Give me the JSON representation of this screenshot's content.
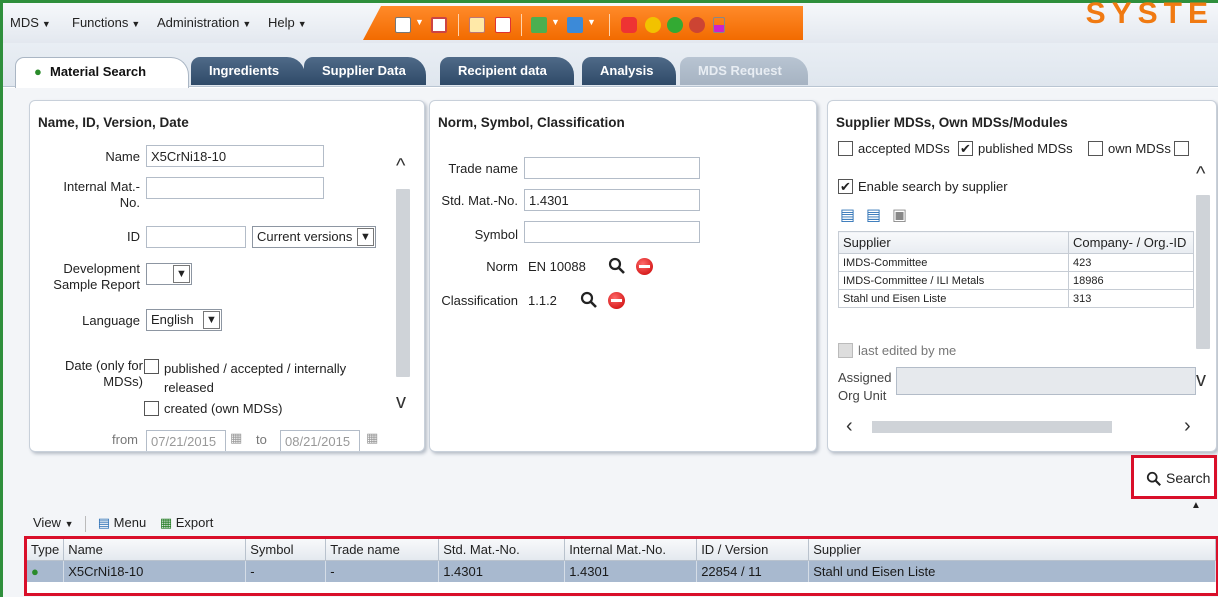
{
  "menu": {
    "items": [
      "MDS",
      "Functions",
      "Administration",
      "Help"
    ],
    "brand": "SYSTE"
  },
  "tabs": [
    {
      "label": "Material Search",
      "state": "active"
    },
    {
      "label": "Ingredients",
      "state": "normal"
    },
    {
      "label": "Supplier Data",
      "state": "normal"
    },
    {
      "label": "Recipient data",
      "state": "normal"
    },
    {
      "label": "Analysis",
      "state": "normal"
    },
    {
      "label": "MDS Request",
      "state": "disabled"
    }
  ],
  "panel_name": {
    "title": "Name, ID, Version, Date",
    "name_label": "Name",
    "name_value": "X5CrNi18-10",
    "internal_label": "Internal Mat.-No.",
    "internal_value": "",
    "id_label": "ID",
    "id_value": "",
    "version_select": "Current versions",
    "dev_label": "Development Sample Report",
    "dev_select": "",
    "language_label": "Language",
    "language_select": "English",
    "date_label": "Date (only for MDSs)",
    "published_label": "published / accepted / internally released",
    "created_label": "created (own MDSs)",
    "from_label": "from",
    "from_value": "07/21/2015",
    "to_label": "to",
    "to_value": "08/21/2015"
  },
  "panel_norm": {
    "title": "Norm, Symbol, Classification",
    "trade_label": "Trade name",
    "trade_value": "",
    "std_label": "Std. Mat.-No.",
    "std_value": "1.4301",
    "symbol_label": "Symbol",
    "symbol_value": "",
    "norm_label": "Norm",
    "norm_value": "EN 10088",
    "class_label": "Classification",
    "class_value": "1.1.2"
  },
  "panel_supplier": {
    "title": "Supplier MDSs, Own MDSs/Modules",
    "accepted_label": "accepted MDSs",
    "accepted_checked": false,
    "published_label": "published MDSs",
    "published_checked": true,
    "own_label": "own MDSs",
    "own_checked": false,
    "enable_label": "Enable search by supplier",
    "enable_checked": true,
    "table_headers": [
      "Supplier",
      "Company- / Org.-ID"
    ],
    "table_rows": [
      [
        "IMDS-Committee",
        "423"
      ],
      [
        "IMDS-Committee / ILI Metals",
        "18986"
      ],
      [
        "Stahl und Eisen Liste",
        "313"
      ]
    ],
    "last_edited_label": "last edited by me",
    "assigned_label": "Assigned Org Unit",
    "assigned_value": ""
  },
  "search": {
    "label": "Search"
  },
  "results": {
    "view_label": "View",
    "menu_label": "Menu",
    "export_label": "Export",
    "headers": [
      "Type",
      "Name",
      "Symbol",
      "Trade name",
      "Std. Mat.-No.",
      "Internal Mat.-No.",
      "ID / Version",
      "Supplier"
    ],
    "rows": [
      [
        "",
        "X5CrNi18-10",
        "-",
        "-",
        "1.4301",
        "1.4301",
        "22854 / 11",
        "Stahl und Eisen Liste"
      ]
    ]
  }
}
